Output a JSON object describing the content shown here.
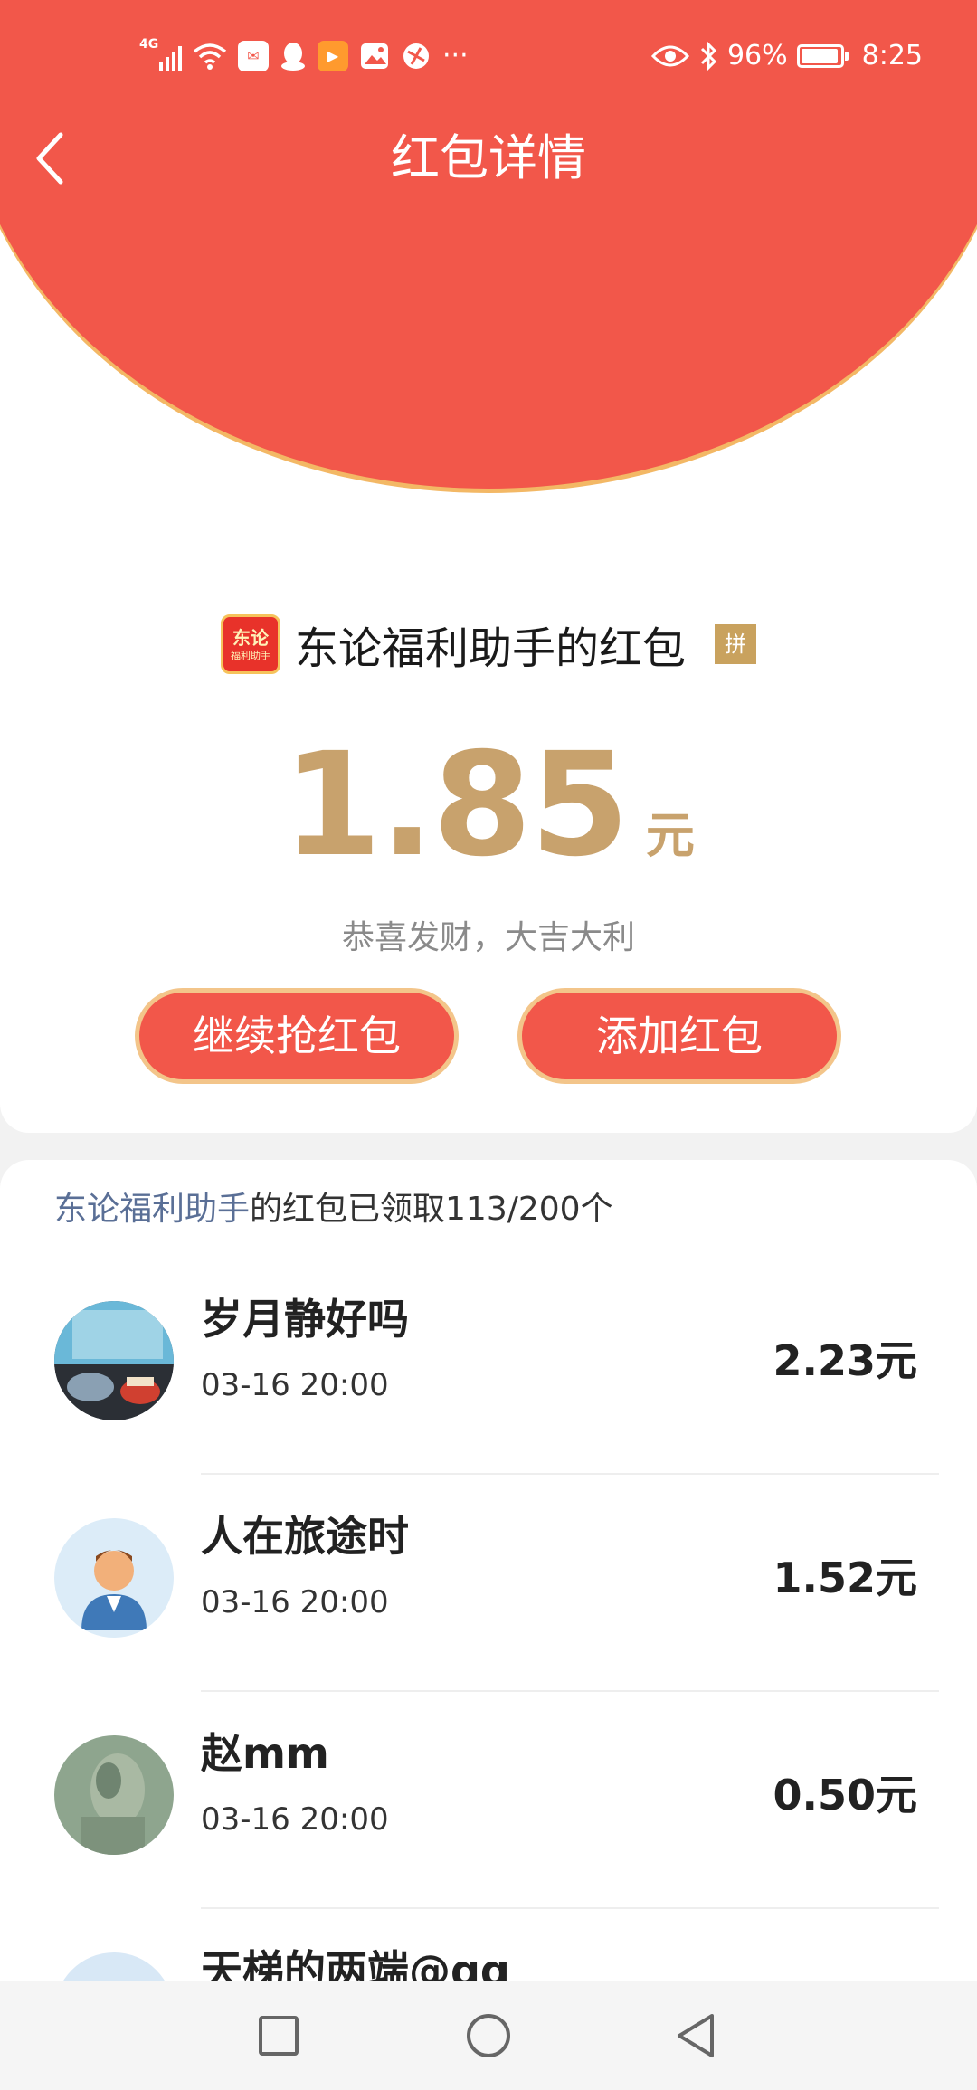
{
  "status_bar": {
    "network": "4G",
    "battery": "96%",
    "time": "8:25"
  },
  "header": {
    "title": "红包详情",
    "back_icon": "back-arrow-icon"
  },
  "envelope": {
    "sender_logo_line1": "东论",
    "sender_logo_line2": "福利助手",
    "sender_title": "东论福利助手的红包",
    "badge": "拼",
    "amount": "1.85",
    "unit": "元",
    "blessing": "恭喜发财，大吉大利"
  },
  "actions": {
    "continue_label": "继续抢红包",
    "add_label": "添加红包"
  },
  "claims": {
    "sender_name": "东论福利助手",
    "summary_text": "的红包已领取113/200个",
    "items": [
      {
        "name": "岁月静好吗",
        "time": "03-16 20:00",
        "amount": "2.23元"
      },
      {
        "name": "人在旅途时",
        "time": "03-16 20:00",
        "amount": "1.52元"
      },
      {
        "name": "赵mm",
        "time": "03-16 20:00",
        "amount": "0.50元"
      },
      {
        "name": "天梯的两端@qq",
        "time": "",
        "amount": ""
      }
    ]
  },
  "colors": {
    "header_red": "#f2574a",
    "amount_gold": "#c8a26d",
    "link_blue": "#5a6f96"
  },
  "system_nav": {
    "recents_icon": "square-icon",
    "home_icon": "circle-icon",
    "back_icon": "triangle-back-icon"
  }
}
